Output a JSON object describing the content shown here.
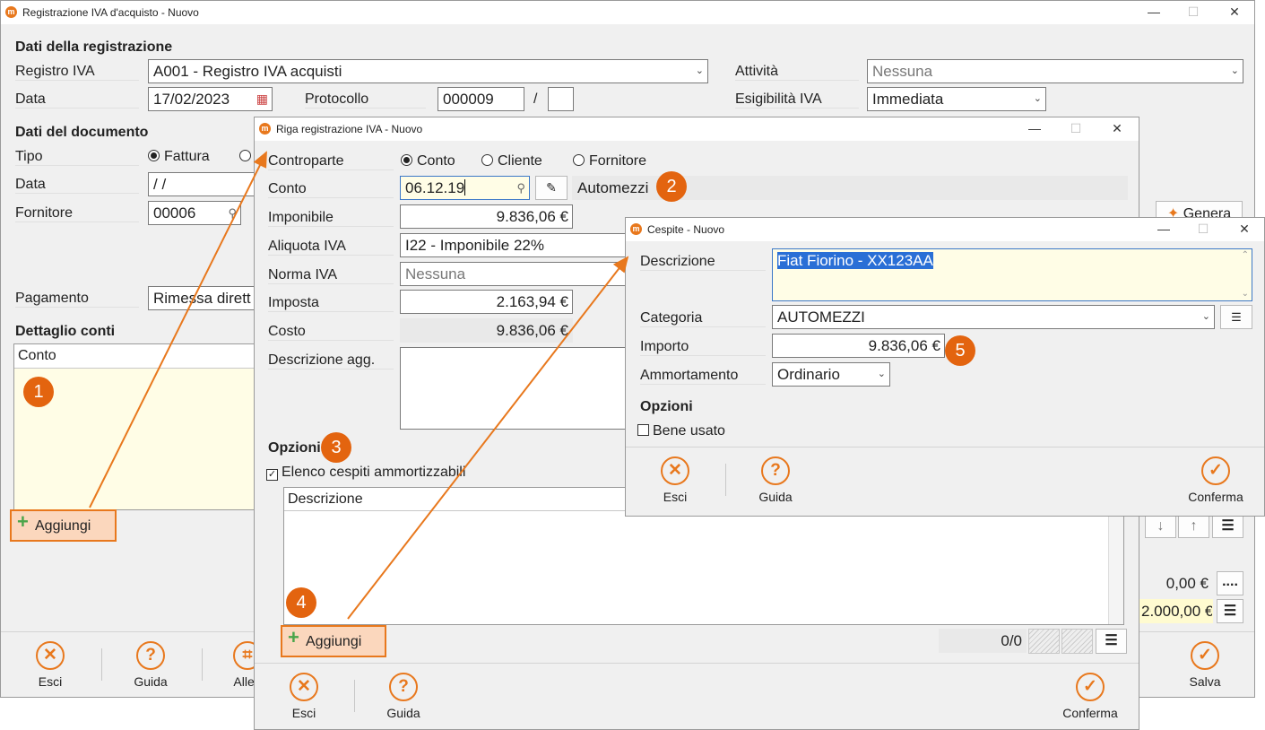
{
  "main": {
    "title": "Registrazione IVA d'acquisto - Nuovo",
    "sec_registrazione": "Dati della registrazione",
    "registro_label": "Registro IVA",
    "registro_value": "A001 - Registro IVA acquisti",
    "data_label": "Data",
    "data_value": "17/02/2023",
    "protocollo_label": "Protocollo",
    "protocollo_value": "000009",
    "protocollo_sep": "/",
    "attivita_label": "Attività",
    "attivita_value": "Nessuna",
    "esigibilita_label": "Esigibilità IVA",
    "esigibilita_value": "Immediata",
    "sec_documento": "Dati del documento",
    "tipo_label": "Tipo",
    "tipo_fattura": "Fattura",
    "doc_data_label": "Data",
    "doc_data_value": " /  /",
    "fornitore_label": "Fornitore",
    "fornitore_value": "00006",
    "genera_label": "Genera",
    "pagamento_label": "Pagamento",
    "pagamento_value": "Rimessa dirett",
    "sec_dettaglio": "Dettaglio conti",
    "col_conto": "Conto",
    "aggiungi": "Aggiungi",
    "total1": "0,00 €",
    "total1_btn": "....",
    "total2": "2.000,00 €",
    "footer": {
      "esci": "Esci",
      "guida": "Guida",
      "allegati": "Alleg",
      "salva": "Salva"
    }
  },
  "riga": {
    "title": "Riga registrazione IVA - Nuovo",
    "contro_label": "Controparte",
    "radio_conto": "Conto",
    "radio_cliente": "Cliente",
    "radio_fornitore": "Fornitore",
    "conto_label": "Conto",
    "conto_value": "06.12.19",
    "conto_desc": "Automezzi",
    "imponibile_label": "Imponibile",
    "imponibile_value": "9.836,06 €",
    "aliquota_label": "Aliquota IVA",
    "aliquota_value": "I22 - Imponibile 22%",
    "norma_label": "Norma IVA",
    "norma_value": "Nessuna",
    "imposta_label": "Imposta",
    "imposta_value": "2.163,94 €",
    "costo_label": "Costo",
    "costo_value": "9.836,06 €",
    "descagg_label": "Descrizione agg.",
    "opzioni": "Opzioni",
    "elenco_label": "Elenco cespiti ammortizzabili",
    "col_descrizione": "Descrizione",
    "aggiungi": "Aggiungi",
    "counter": "0/0",
    "footer": {
      "esci": "Esci",
      "guida": "Guida",
      "conferma": "Conferma"
    }
  },
  "cespite": {
    "title": "Cespite - Nuovo",
    "descrizione_label": "Descrizione",
    "descrizione_value": "Fiat Fiorino - XX123AA",
    "categoria_label": "Categoria",
    "categoria_value": "AUTOMEZZI",
    "importo_label": "Importo",
    "importo_value": "9.836,06 €",
    "ammortamento_label": "Ammortamento",
    "ammortamento_value": "Ordinario",
    "opzioni": "Opzioni",
    "bene_usato": "Bene usato",
    "footer": {
      "esci": "Esci",
      "guida": "Guida",
      "conferma": "Conferma"
    }
  },
  "badges": {
    "b1": "1",
    "b2": "2",
    "b3": "3",
    "b4": "4",
    "b5": "5"
  },
  "colors": {
    "accent": "#e8781d",
    "badge": "#e3640f",
    "highlight_bg": "#fbd7bd",
    "note_bg": "#fffde6"
  }
}
